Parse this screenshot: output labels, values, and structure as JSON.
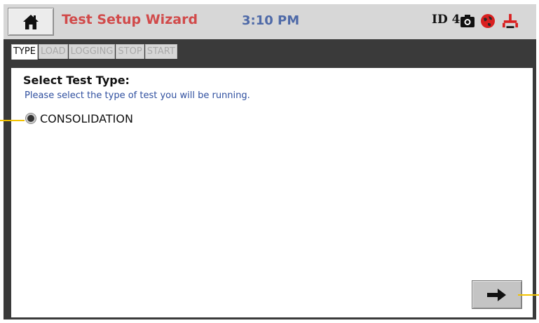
{
  "header": {
    "home_icon": "home-icon",
    "title": "Test Setup Wizard",
    "time": "3:10 PM",
    "device_id": "ID 4",
    "icons": [
      "camera-icon",
      "network-globe-icon",
      "valve-icon"
    ]
  },
  "tabs": [
    {
      "label": "TYPE",
      "active": true
    },
    {
      "label": "LOAD",
      "active": false
    },
    {
      "label": "LOGGING",
      "active": false
    },
    {
      "label": "STOP",
      "active": false
    },
    {
      "label": "START",
      "active": false
    }
  ],
  "main": {
    "title": "Select Test Type:",
    "subtitle": "Please select the type of test you will be running.",
    "options": [
      {
        "label": "CONSOLIDATION",
        "selected": true
      }
    ]
  },
  "footer": {
    "next_icon": "arrow-right-icon"
  },
  "colors": {
    "title": "#d14a4a",
    "time": "#4f6aa8",
    "subtitle": "#2f4f9f",
    "callout": "#f2c200"
  }
}
